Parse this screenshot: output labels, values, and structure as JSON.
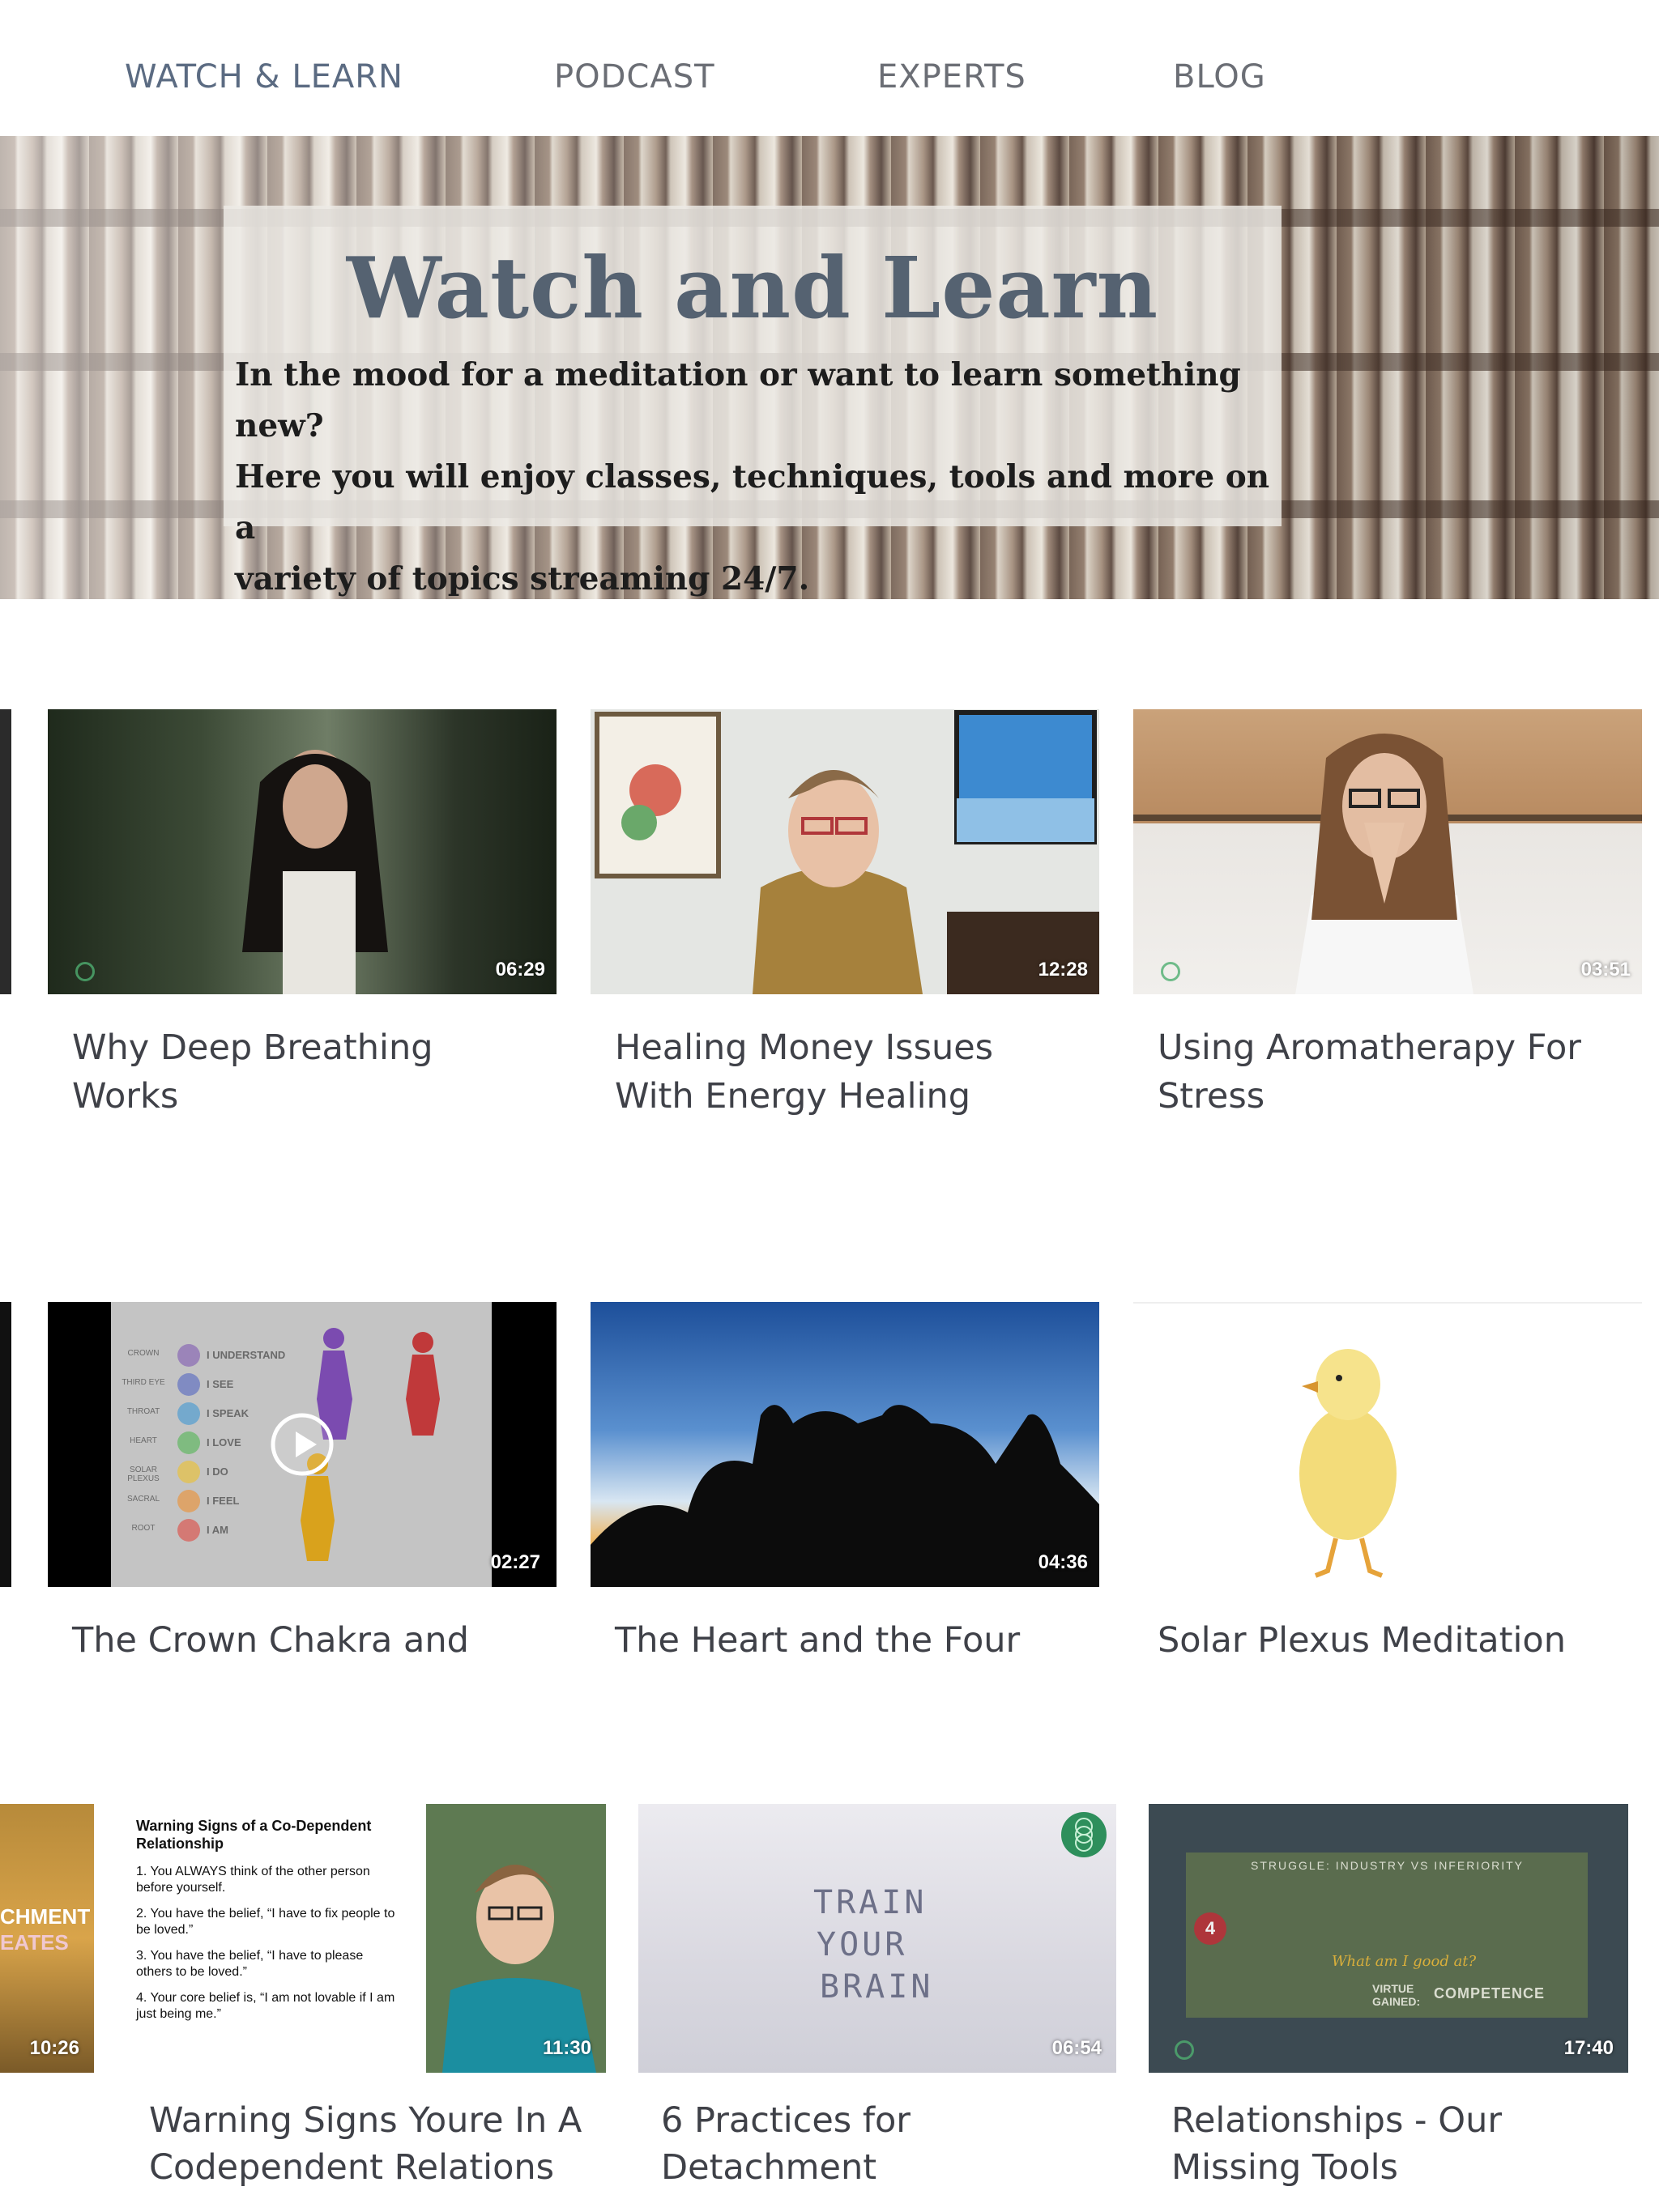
{
  "nav": {
    "items": [
      {
        "label": "WATCH & LEARN",
        "active": true
      },
      {
        "label": "PODCAST",
        "active": false
      },
      {
        "label": "EXPERTS",
        "active": false
      },
      {
        "label": "BLOG",
        "active": false
      }
    ]
  },
  "hero": {
    "title": "Watch and Learn",
    "line1": "In the mood for a meditation or want to learn something new?",
    "line2": "Here you will enjoy classes, techniques, tools and more on a",
    "line3": "variety of topics streaming 24/7."
  },
  "videos": [
    {
      "title_l1": "Why Deep Breathing",
      "title_l2": "Works",
      "duration": "06:29"
    },
    {
      "title_l1": "Healing Money Issues",
      "title_l2": "With Energy Healing",
      "duration": "12:28"
    },
    {
      "title_l1": "Using Aromatherapy For",
      "title_l2": "Stress",
      "duration": "03:51"
    },
    {
      "title_l1": "The Crown Chakra and",
      "duration": "02:27"
    },
    {
      "title_l1": "The Heart and the Four",
      "duration": "04:36"
    },
    {
      "title_l1": "Solar Plexus Meditation"
    },
    {
      "duration": "10:26",
      "thumb_text1": "CHMENT",
      "thumb_text2": "EATES"
    },
    {
      "title_l1": "Warning Signs Youre In A",
      "title_l2": "Codependent Relations",
      "duration": "11:30",
      "slide_title": "Warning Signs of a Co-Dependent Relationship",
      "slide_points": [
        "1.  You ALWAYS think of the other person before yourself.",
        "2.  You have the belief, “I have to fix people to be loved.”",
        "3.  You have the belief, “I have to please others to be loved.”",
        "4.  Your core belief is, “I am not lovable if I am just being me.”"
      ]
    },
    {
      "title_l1": "6 Practices for",
      "title_l2": "Detachment",
      "duration": "06:54",
      "thumb_words": [
        "TRAIN",
        "YOUR",
        "BRAIN"
      ]
    },
    {
      "title_l1": "Relationships - Our",
      "title_l2": "Missing Tools",
      "duration": "17:40",
      "slide_header": "STRUGGLE: INDUSTRY VS INFERIORITY",
      "slide_number": "4",
      "slide_question": "What am I good at?",
      "slide_virtue": "VIRTUE GAINED:",
      "slide_competence": "COMPETENCE"
    }
  ],
  "chakra": {
    "labels": [
      "CROWN",
      "THIRD EYE",
      "THROAT",
      "HEART",
      "SOLAR PLEXUS",
      "SACRAL",
      "ROOT"
    ],
    "affirmations": [
      "I UNDERSTAND",
      "I SEE",
      "I SPEAK",
      "I LOVE",
      "I DO",
      "I FEEL",
      "I AM"
    ],
    "colors": [
      "#8e6fb5",
      "#6a78c2",
      "#5aa0d0",
      "#68b86a",
      "#e6c24a",
      "#e59a4c",
      "#d9605a"
    ]
  }
}
